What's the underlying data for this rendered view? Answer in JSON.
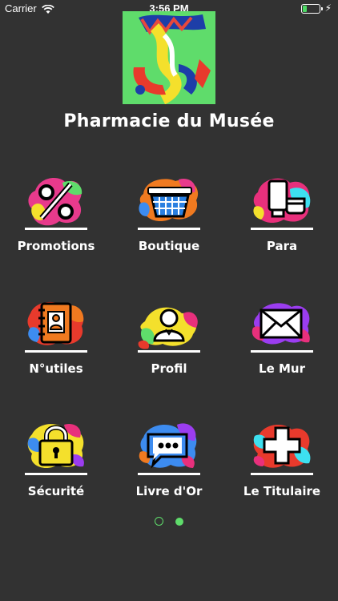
{
  "status_bar": {
    "carrier": "Carrier",
    "time": "3:56 PM"
  },
  "app": {
    "title": "Pharmacie du Musée"
  },
  "menu": [
    {
      "label": "Promotions",
      "icon": "percent-icon"
    },
    {
      "label": "Boutique",
      "icon": "shopping-basket-icon"
    },
    {
      "label": "Para",
      "icon": "cosmetics-icon"
    },
    {
      "label": "N°utiles",
      "icon": "contact-book-icon"
    },
    {
      "label": "Profil",
      "icon": "user-profile-icon"
    },
    {
      "label": "Le Mur",
      "icon": "envelope-icon"
    },
    {
      "label": "Sécurité",
      "icon": "padlock-icon"
    },
    {
      "label": "Livre d'Or",
      "icon": "chat-bubbles-icon"
    },
    {
      "label": "Le Titulaire",
      "icon": "medical-cross-icon"
    }
  ],
  "pagination": {
    "pages": 2,
    "active_page": 2
  },
  "colors": {
    "background": "#323232",
    "accent": "#5fdc6b"
  }
}
